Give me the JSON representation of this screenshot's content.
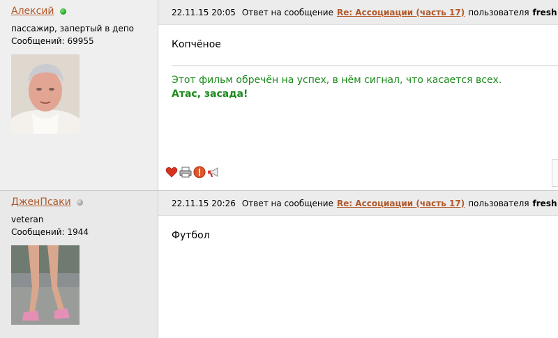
{
  "posts": [
    {
      "username": "Алексий",
      "online": true,
      "status": "пассажир, запертый в депо",
      "messages_label": "Сообщений: 69955",
      "date": "22.11.15 20:05",
      "reply_prefix": "Ответ на сообщение",
      "thread_link": "Re: Ассоциации (часть 17)",
      "by_label": "пользователя",
      "reply_user": "fresh",
      "text": "Копчёное",
      "signature_line1": "Этот фильм обречён на успех, в нём сигнал, что касается всех.",
      "signature_line2": "Атас, засада!",
      "action_icons": [
        "heart-icon",
        "print-icon",
        "report-icon",
        "megaphone-icon"
      ]
    },
    {
      "username": "ДженПсаки",
      "online": false,
      "status": "veteran",
      "messages_label": "Сообщений: 1944",
      "date": "22.11.15 20:26",
      "reply_prefix": "Ответ на сообщение",
      "thread_link": "Re: Ассоциации (часть 17)",
      "by_label": "пользователя",
      "reply_user": "fresh",
      "text": "Футбол"
    }
  ],
  "colors": {
    "link": "#b1592a",
    "signature_green": "#1a8a1a",
    "online_dot": "#17a317",
    "offline_dot": "#9c9c9c",
    "sidebar_bg": "#efefef",
    "header_bg": "#ececec"
  }
}
